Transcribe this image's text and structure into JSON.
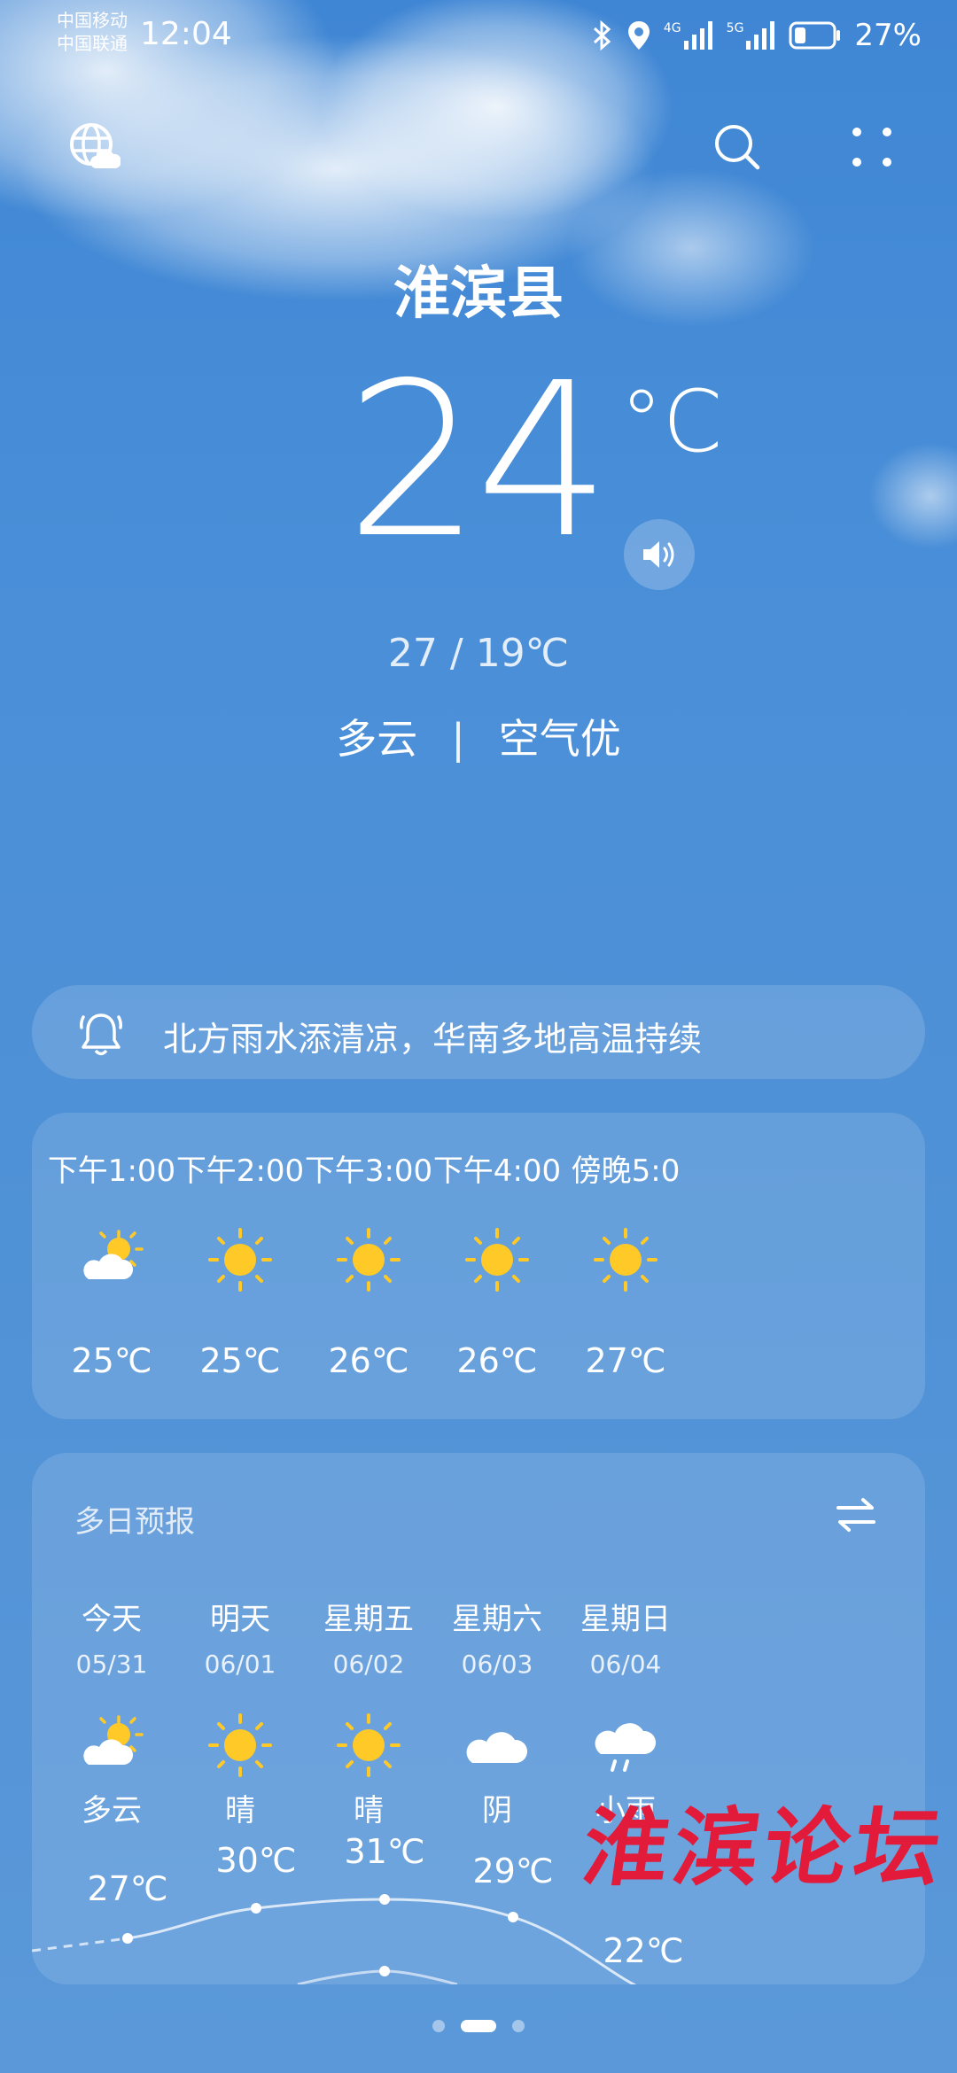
{
  "status_bar": {
    "carrier_1": "中国移动",
    "carrier_2": "中国联通",
    "time": "12:04",
    "network_1": "4G",
    "network_2": "5G",
    "battery": "27%"
  },
  "header": {
    "city": "淮滨县"
  },
  "current": {
    "temperature": "24",
    "unit": "°C",
    "high_low": "27 / 19℃",
    "condition": "多云",
    "separator": "|",
    "air_quality": "空气优"
  },
  "alert": {
    "text": "北方雨水添清凉，华南多地高温持续"
  },
  "hourly": [
    {
      "time": "下午1:00",
      "icon": "partly-cloudy-icon",
      "temp": "25℃"
    },
    {
      "time": "下午2:00",
      "icon": "sunny-icon",
      "temp": "25℃"
    },
    {
      "time": "下午3:00",
      "icon": "sunny-icon",
      "temp": "26℃"
    },
    {
      "time": "下午4:00",
      "icon": "sunny-icon",
      "temp": "26℃"
    },
    {
      "time": "傍晚5:0",
      "icon": "sunny-icon",
      "temp": "27℃"
    }
  ],
  "daily": {
    "title": "多日预报",
    "days": [
      {
        "day": "今天",
        "date": "05/31",
        "icon": "partly-cloudy-icon",
        "weather": "多云",
        "high": "27℃"
      },
      {
        "day": "明天",
        "date": "06/01",
        "icon": "sunny-icon",
        "weather": "晴",
        "high": "30℃"
      },
      {
        "day": "星期五",
        "date": "06/02",
        "icon": "sunny-icon",
        "weather": "晴",
        "high": "31℃"
      },
      {
        "day": "星期六",
        "date": "06/03",
        "icon": "cloudy-icon",
        "weather": "阴",
        "high": "29℃"
      },
      {
        "day": "星期日",
        "date": "06/04",
        "icon": "light-rain-icon",
        "weather": "小雨",
        "high": "22℃"
      }
    ]
  },
  "watermark": "淮滨论坛",
  "colors": {
    "background": "#4a8fd8",
    "sun": "#ffc928",
    "watermark": "#e21b3b"
  }
}
